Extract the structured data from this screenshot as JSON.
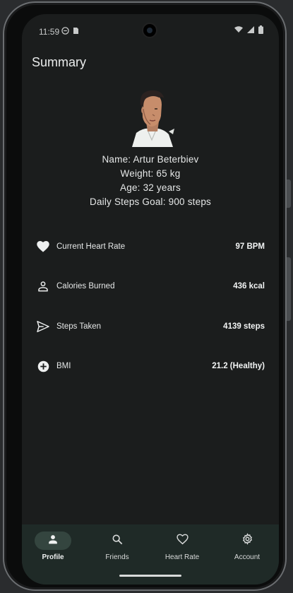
{
  "status_bar": {
    "time": "11:59"
  },
  "header": {
    "title": "Summary"
  },
  "profile": {
    "name_line": "Name: Artur Beterbiev",
    "weight_line": "Weight: 65 kg",
    "age_line": "Age: 32 years",
    "goal_line": "Daily Steps Goal: 900 steps"
  },
  "stats": [
    {
      "icon": "heart-icon",
      "label": "Current Heart Rate",
      "value": "97 BPM"
    },
    {
      "icon": "person-icon",
      "label": "Calories Burned",
      "value": "436 kcal"
    },
    {
      "icon": "send-icon",
      "label": "Steps Taken",
      "value": "4139 steps"
    },
    {
      "icon": "add-circle-icon",
      "label": "BMI",
      "value": "21.2 (Healthy)"
    }
  ],
  "bottom_nav": {
    "items": [
      {
        "label": "Profile",
        "icon": "person-icon",
        "active": true
      },
      {
        "label": "Friends",
        "icon": "search-icon",
        "active": false
      },
      {
        "label": "Heart Rate",
        "icon": "heart-outline-icon",
        "active": false
      },
      {
        "label": "Account",
        "icon": "gear-icon",
        "active": false
      }
    ]
  },
  "colors": {
    "background": "#1b1d1d",
    "nav_background": "#1f2a27",
    "active_pill": "#34453f",
    "text": "#e6e8e8"
  }
}
